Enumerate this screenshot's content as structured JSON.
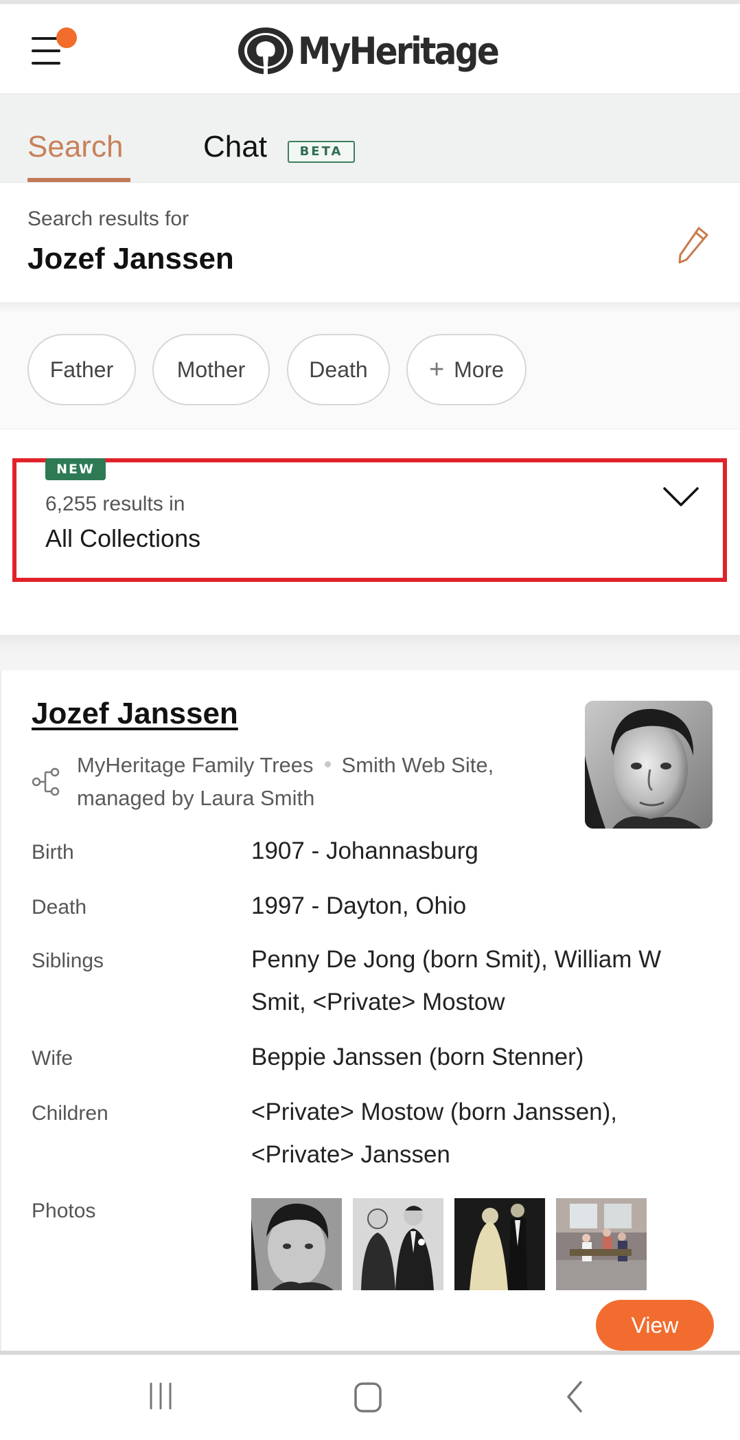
{
  "header": {
    "logo_text": "MyHeritage",
    "menu_icon": "hamburger-menu-icon",
    "notification_dot_color": "#f26c2c"
  },
  "tabs": [
    {
      "label": "Search",
      "active": true
    },
    {
      "label": "Chat",
      "badge": "BETA",
      "active": false
    }
  ],
  "search_summary": {
    "label": "Search results for",
    "query_name": "Jozef Janssen",
    "edit_icon": "pencil-icon"
  },
  "filter_chips": [
    {
      "label": "Father"
    },
    {
      "label": "Mother"
    },
    {
      "label": "Death"
    },
    {
      "label": "More",
      "icon": "plus-icon"
    }
  ],
  "collections": {
    "badge": "NEW",
    "results_count_text": "6,255 results in",
    "collection_name": "All Collections",
    "highlight_color": "#e0222a"
  },
  "result": {
    "name": "Jozef Janssen",
    "source_collection": "MyHeritage Family Trees",
    "source_site": "Smith Web Site, managed by Laura Smith",
    "facts": [
      {
        "label": "Birth",
        "value": "1907 - Johannasburg"
      },
      {
        "label": "Death",
        "value": "1997 - Dayton, Ohio"
      },
      {
        "label": "Siblings",
        "value": "Penny De Jong (born Smit), William W Smit, <Private> Mostow"
      },
      {
        "label": "Wife",
        "value": "Beppie Janssen (born Stenner)"
      },
      {
        "label": "Children",
        "value": "<Private> Mostow (born Janssen), <Private> Janssen"
      },
      {
        "label": "Photos",
        "value": ""
      }
    ],
    "photo_count": 4,
    "view_button": "View",
    "accent_color": "#f26c30"
  },
  "navbar": {
    "recents_icon": "recent-apps-icon",
    "home_icon": "home-icon",
    "back_icon": "back-icon"
  }
}
